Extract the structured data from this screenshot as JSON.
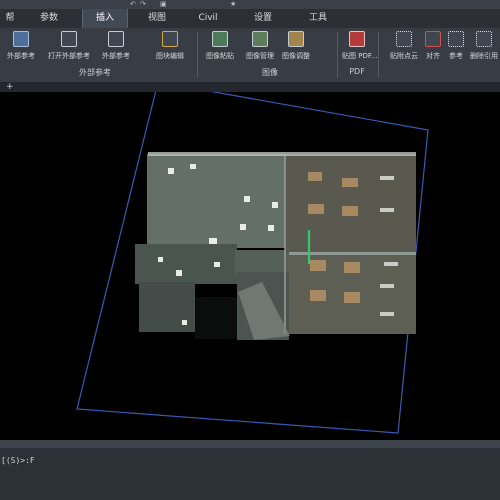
{
  "quick_access": {
    "icons": [
      "undo-icon",
      "redo-icon",
      "cube-icon",
      "star-icon"
    ]
  },
  "tabs": [
    {
      "label": "帮"
    },
    {
      "label": "参数"
    },
    {
      "label": "插入",
      "active": true
    },
    {
      "label": "视图"
    },
    {
      "label": "Civil"
    },
    {
      "label": "设置"
    },
    {
      "label": "工具"
    }
  ],
  "ribbon": {
    "buttons": [
      {
        "label": "外部参考",
        "icon": "xref-attach-icon"
      },
      {
        "label": "打开外部参考",
        "icon": "xref-open-icon"
      },
      {
        "label": "外部参考",
        "icon": "xref-manager-icon"
      },
      {
        "label": "图块编辑",
        "icon": "block-edit-icon"
      },
      {
        "label": "图像粘贴",
        "icon": "image-paste-icon"
      },
      {
        "label": "图像管理",
        "icon": "image-manage-icon"
      },
      {
        "label": "图像调整",
        "icon": "image-adjust-icon"
      },
      {
        "label": "贴图 PDF...",
        "icon": "pdf-icon"
      },
      {
        "label": "贴附点云",
        "icon": "point-cloud-icon"
      },
      {
        "label": "对齐",
        "icon": "align-icon"
      },
      {
        "label": "参考",
        "icon": "reference-icon"
      },
      {
        "label": "删除引用",
        "icon": "remove-reference-icon"
      }
    ],
    "groups": [
      {
        "label": "外部参考"
      },
      {
        "label": "图像"
      },
      {
        "label": "PDF"
      }
    ]
  },
  "doc_tabs": {
    "new_tab": "+"
  },
  "command_line": {
    "text": "[(S)>:F"
  },
  "colors": {
    "accent": "#3a5bb5",
    "ribbon_bg": "#383d45",
    "canvas_bg": "#000000"
  }
}
